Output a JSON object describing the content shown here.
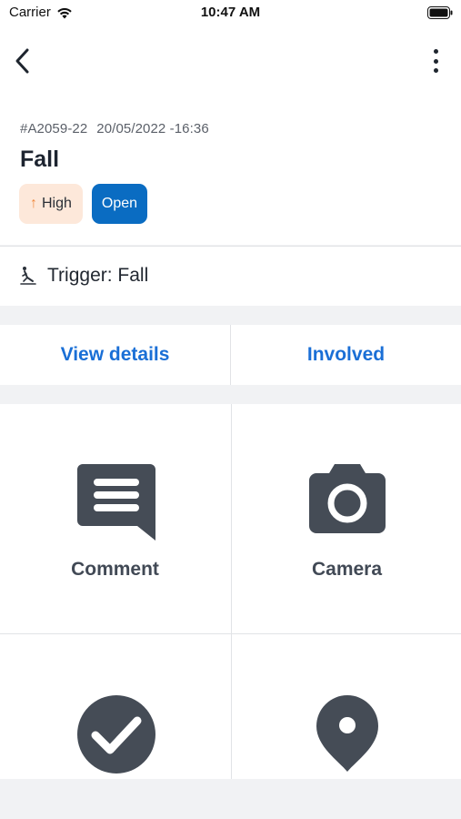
{
  "status_bar": {
    "carrier": "Carrier",
    "time": "10:47 AM",
    "icons": [
      "wifi-icon",
      "battery-icon"
    ]
  },
  "nav": {
    "back_icon": "chevron-left-icon",
    "more_icon": "more-vertical-icon"
  },
  "incident": {
    "id": "#A2059-22",
    "datetime": "20/05/2022 -16:36",
    "title": "Fall",
    "priority": {
      "arrow": "↑",
      "label": "High",
      "color": "#fde8da",
      "arrow_color": "#f08a3e"
    },
    "status": {
      "label": "Open",
      "color": "#0a6cc2"
    }
  },
  "trigger": {
    "icon": "fall-icon",
    "label": "Trigger: Fall"
  },
  "tabs": [
    {
      "label": "View details"
    },
    {
      "label": "Involved"
    }
  ],
  "actions": [
    {
      "label": "Comment",
      "icon": "comment-icon"
    },
    {
      "label": "Camera",
      "icon": "camera-icon"
    },
    {
      "label": "",
      "icon": "check-circle-icon"
    },
    {
      "label": "",
      "icon": "location-pin-icon"
    }
  ],
  "colors": {
    "accent": "#1a6fd6",
    "icon": "#454c56",
    "background": "#f1f2f4"
  }
}
